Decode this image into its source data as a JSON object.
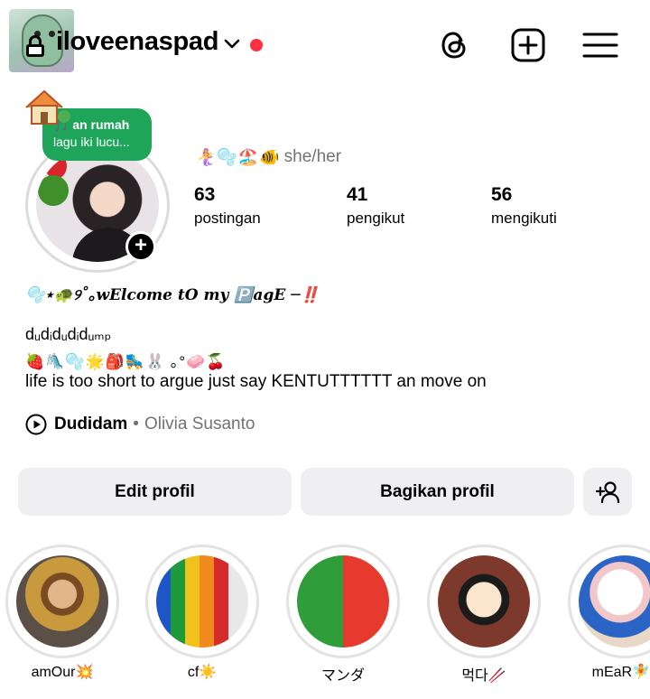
{
  "header": {
    "username": "iloveenaspad",
    "icons": {
      "lock": "lock-icon",
      "chevron": "chevron-down-icon",
      "threads": "threads-icon",
      "create": "plus-square-icon",
      "menu": "hamburger-menu-icon"
    },
    "notification_dot_color": "#ff3040"
  },
  "profile": {
    "note": {
      "line1": "🎵 an rumah",
      "line2": "lagu iki lucu...",
      "bg_color": "#1fa55a"
    },
    "pronoun_emoji": "🧜‍♀️🫧🏖️🐠",
    "pronouns": "she/her",
    "stats": [
      {
        "value": "63",
        "label": "postingan"
      },
      {
        "value": "41",
        "label": "pengikut"
      },
      {
        "value": "56",
        "label": "mengikuti"
      }
    ]
  },
  "bio": {
    "title": "🫧⋆🐢୨˚｡wElcome tO my 🅿️agE ─‼️",
    "name": "dᵤdᵢdᵤdᵢdᵤₘₚ",
    "emoji_line": "🍓🛝🫧🌟🎒🛼🐰 ｡°🧼🍒",
    "text": "life is too short to argue just say KENTUTTTTTT an move on",
    "music": {
      "title": "Dudidam",
      "separator": "•",
      "artist": "Olivia Susanto"
    }
  },
  "buttons": {
    "edit": "Edit profil",
    "share": "Bagikan profil",
    "add_user_icon": "add-person-icon",
    "bg_color": "#efeff2"
  },
  "highlights": [
    {
      "label": "amOur💥"
    },
    {
      "label": "cf☀️"
    },
    {
      "label": "マンダ"
    },
    {
      "label": "먹다🥢"
    },
    {
      "label": "mEaR🧚"
    }
  ]
}
